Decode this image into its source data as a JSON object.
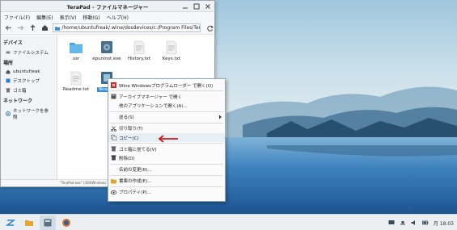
{
  "window": {
    "title": "TeraPad - ファイルマネージャー",
    "controls": [
      "minimize",
      "maximize",
      "close"
    ]
  },
  "menubar": [
    "ファイル(F)",
    "編集(E)",
    "表示(V)",
    "移動(G)",
    "ヘルプ(H)"
  ],
  "toolbar": {
    "path": "/home/ubuntufreak/.wine/dosdevices/c:/Program Files/TeraPad/"
  },
  "sidebar": {
    "sections": [
      {
        "heading": "デバイス",
        "items": [
          {
            "label": "ファイルシステム",
            "icon": "drive-icon"
          }
        ]
      },
      {
        "heading": "場所",
        "items": [
          {
            "label": "ubuntufreak",
            "icon": "home-icon"
          },
          {
            "label": "デスクトップ",
            "icon": "desktop-icon"
          },
          {
            "label": "ゴミ箱",
            "icon": "trash-icon"
          }
        ]
      },
      {
        "heading": "ネットワーク",
        "items": [
          {
            "label": "ネットワークを参照",
            "icon": "network-icon"
          }
        ]
      }
    ]
  },
  "files": [
    {
      "name": "usr",
      "icon": "folder-icon"
    },
    {
      "name": "epuninst.exe",
      "icon": "exe-icon"
    },
    {
      "name": "History.txt",
      "icon": "text-file-icon"
    },
    {
      "name": "Keys.txt",
      "icon": "text-file-icon"
    },
    {
      "name": "Readme.txt",
      "icon": "text-file-icon"
    },
    {
      "name": "TeraPad",
      "icon": "exe-icon",
      "selected": true
    }
  ],
  "statusbar": "\"TeraPad.exe\" (300/Windows 実行ファイル)",
  "context_menu": [
    {
      "label": "Wine Windowsプログラムローダー で開く(O)",
      "icon": "wine-icon"
    },
    {
      "sep": true
    },
    {
      "label": "アーカイブマネージャー で開く",
      "icon": "archive-icon"
    },
    {
      "label": "他のアプリケーションで開く(A)...",
      "icon": ""
    },
    {
      "sep": true
    },
    {
      "label": "送る(S)",
      "icon": "",
      "submenu": true
    },
    {
      "sep": true
    },
    {
      "label": "切り取り(T)",
      "icon": "cut-icon"
    },
    {
      "label": "コピー(C)",
      "icon": "copy-icon",
      "highlight": true
    },
    {
      "sep": true
    },
    {
      "label": "ゴミ箱に捨てる(V)",
      "icon": "trash-icon"
    },
    {
      "label": "削除(D)",
      "icon": "delete-icon"
    },
    {
      "sep": true
    },
    {
      "label": "名前の変更(R)...",
      "icon": ""
    },
    {
      "sep": true
    },
    {
      "label": "書庫の作成(E)...",
      "icon": "compress-icon"
    },
    {
      "sep": true
    },
    {
      "label": "プロパティ(P)...",
      "icon": "properties-icon"
    }
  ],
  "taskbar": {
    "clock": "月 18:03",
    "apps": [
      "zorin-menu-icon",
      "file-manager-icon",
      "terapad-task-icon",
      "firefox-icon"
    ]
  },
  "colors": {
    "selection": "#3a8fd8",
    "accent_arrow": "#cc1a1a"
  }
}
